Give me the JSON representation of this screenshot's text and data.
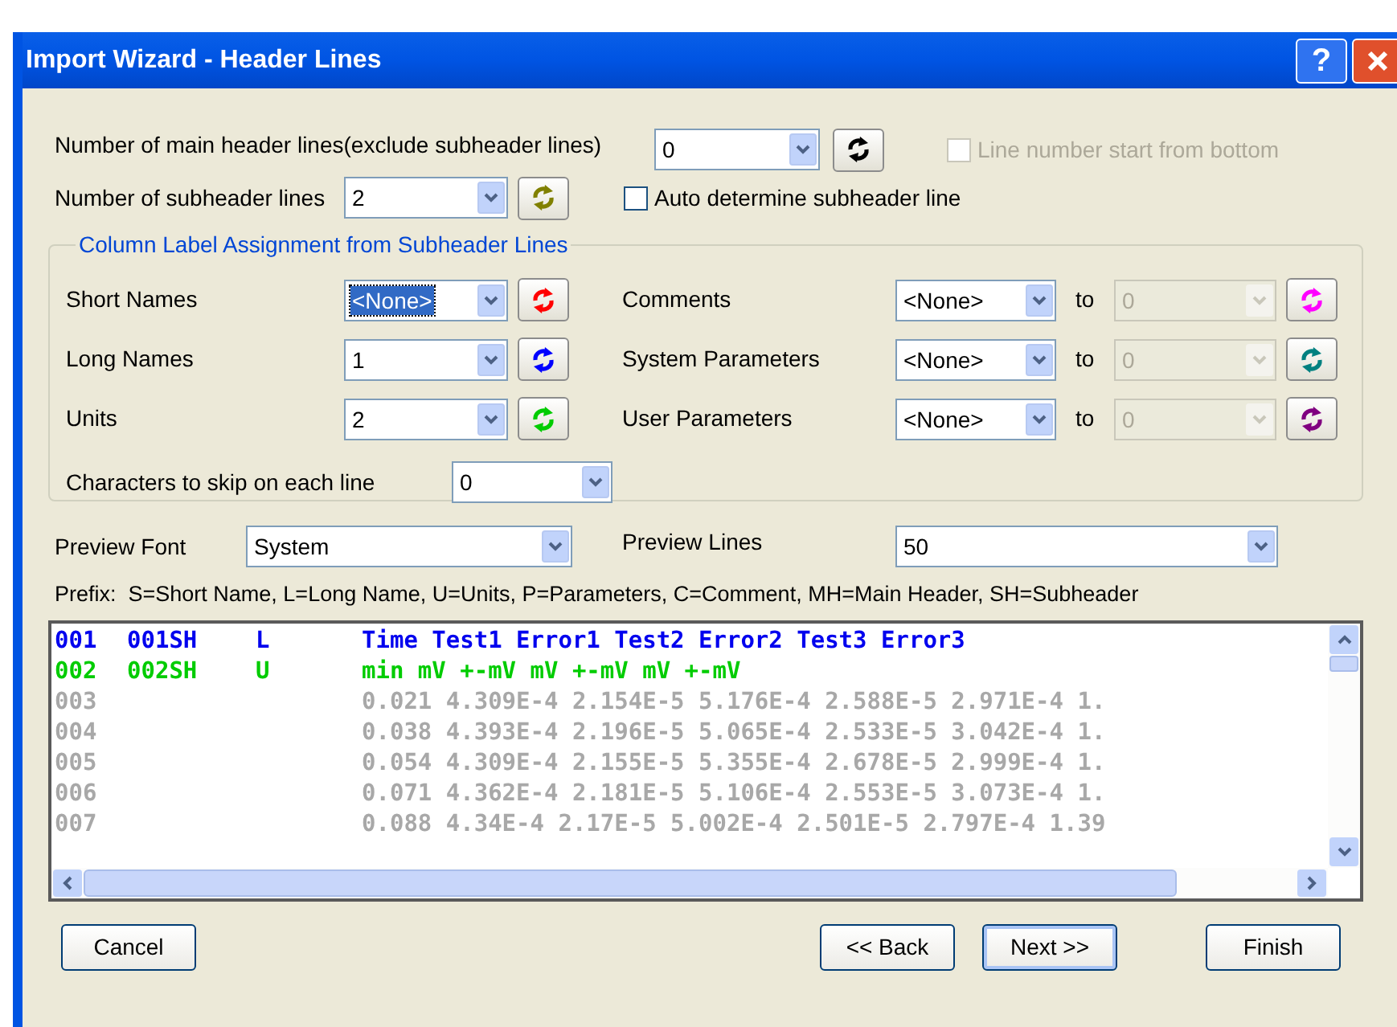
{
  "window": {
    "title": "Import Wizard - Header Lines",
    "help": "?"
  },
  "main_header": {
    "label": "Number of main header lines(exclude subheader lines)",
    "value": "0",
    "refresh": {
      "color": "#000000"
    }
  },
  "line_from_bottom": {
    "label": "Line number start from bottom",
    "checked": false,
    "disabled": true
  },
  "subheader": {
    "label": "Number of subheader lines",
    "value": "2",
    "refresh": {
      "color": "#808000"
    }
  },
  "auto_determine": {
    "label": "Auto determine subheader line",
    "checked": false,
    "disabled": false
  },
  "assignment": {
    "title": "Column Label Assignment from Subheader Lines",
    "rows": [
      {
        "left": {
          "label": "Short Names",
          "value": "<None>",
          "highlighted": true,
          "refresh": {
            "color": "#ff0000"
          }
        },
        "right": {
          "label": "Comments",
          "value": "<None>",
          "to_label": "to",
          "to_value": "0",
          "refresh": {
            "color": "#ff00ff"
          }
        }
      },
      {
        "left": {
          "label": "Long Names",
          "value": "1",
          "highlighted": false,
          "refresh": {
            "color": "#0000ff"
          }
        },
        "right": {
          "label": "System Parameters",
          "value": "<None>",
          "to_label": "to",
          "to_value": "0",
          "refresh": {
            "color": "#008080"
          }
        }
      },
      {
        "left": {
          "label": "Units",
          "value": "2",
          "highlighted": false,
          "refresh": {
            "color": "#00cc00"
          }
        },
        "right": {
          "label": "User Parameters",
          "value": "<None>",
          "to_label": "to",
          "to_value": "0",
          "refresh": {
            "color": "#800080"
          }
        }
      }
    ],
    "skip": {
      "label": "Characters to skip on each line",
      "value": "0"
    }
  },
  "preview_font": {
    "label": "Preview Font",
    "value": "System"
  },
  "preview_lines": {
    "label": "Preview Lines",
    "value": "50"
  },
  "prefix_note": "Prefix:  S=Short Name, L=Long Name, U=Units, P=Parameters, C=Comment, MH=Main Header, SH=Subheader",
  "preview": [
    {
      "kind": "long_name",
      "line": "001",
      "tag": "001SH",
      "type": "L",
      "text": "Time Test1 Error1 Test2 Error2 Test3 Error3"
    },
    {
      "kind": "units",
      "line": "002",
      "tag": "002SH",
      "type": "U",
      "text": "min mV +-mV mV +-mV mV +-mV"
    },
    {
      "kind": "data",
      "line": "003",
      "text": "0.021 4.309E-4 2.154E-5 5.176E-4 2.588E-5 2.971E-4 1."
    },
    {
      "kind": "data",
      "line": "004",
      "text": "0.038 4.393E-4 2.196E-5 5.065E-4 2.533E-5 3.042E-4 1."
    },
    {
      "kind": "data",
      "line": "005",
      "text": "0.054 4.309E-4 2.155E-5 5.355E-4 2.678E-5 2.999E-4 1."
    },
    {
      "kind": "data",
      "line": "006",
      "text": "0.071 4.362E-4 2.181E-5 5.106E-4 2.553E-5 3.073E-4 1."
    },
    {
      "kind": "data",
      "line": "007",
      "text": "0.088 4.34E-4 2.17E-5 5.002E-4 2.501E-5 2.797E-4 1.39"
    }
  ],
  "buttons": [
    {
      "label": "Cancel",
      "default": false
    },
    {
      "label": "<< Back",
      "default": false
    },
    {
      "label": "Next >>",
      "default": true
    },
    {
      "label": "Finish",
      "default": false
    }
  ]
}
